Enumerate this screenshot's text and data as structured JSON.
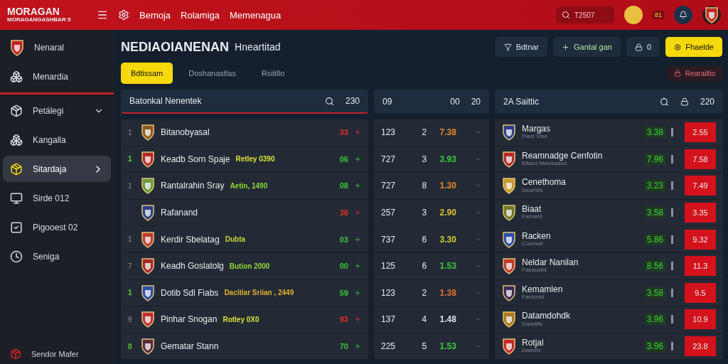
{
  "top_bar": {
    "brand": "MORAGAN",
    "brand_sub": "MORAGANGASHBAR 5",
    "nav": [
      "Bemoja",
      "Rolamiga",
      "Memenagua"
    ],
    "search": {
      "placeholder": "T2507"
    },
    "badge": "81"
  },
  "sidebar": {
    "items": [
      {
        "label": "Nenaral",
        "selected": false,
        "submenu": false
      },
      {
        "label": "Menardia",
        "selected": false,
        "submenu": false
      },
      {
        "label": "Petálegi",
        "selected": false,
        "submenu": true,
        "expanded": true
      },
      {
        "label": "Kangalla",
        "selected": false,
        "submenu": false
      },
      {
        "label": "Sitardaja",
        "selected": true,
        "submenu": true,
        "expanded": false
      },
      {
        "label": "Sirde 012",
        "selected": false,
        "submenu": false
      },
      {
        "label": "Pigooest 02",
        "selected": false,
        "submenu": false
      },
      {
        "label": "Seniga",
        "selected": false,
        "submenu": false
      }
    ],
    "footer": "Sendor Mafer"
  },
  "header": {
    "title": "NEDIAOIANENAN",
    "subtitle": "Hneartitad",
    "actions": [
      {
        "kind": "outline",
        "label": "Bdtnar"
      },
      {
        "kind": "green",
        "label": "Gantal gan"
      },
      {
        "kind": "icon",
        "label": "0"
      },
      {
        "kind": "primary",
        "label": "Fhaelde"
      }
    ]
  },
  "filters": [
    {
      "label": "Bdtissam",
      "selected": true
    },
    {
      "label": "Doshanastlas",
      "selected": false
    },
    {
      "label": "Rsitillo",
      "selected": false
    }
  ],
  "alert": "Rearailtio",
  "left_table": {
    "title": "Batonkal Nenentek",
    "count": "230",
    "rows": [
      {
        "rank": "1",
        "live": false,
        "name": "Bitanobyasal",
        "score": "33",
        "up": false,
        "color": "#8a5a1c"
      },
      {
        "rank": "1",
        "live": true,
        "name": "Keadb Sorn Spaje",
        "tag": {
          "text": "Retley 0390",
          "color": "#d8e03a"
        },
        "score": "06",
        "up": true,
        "color": "#b52a2a"
      },
      {
        "rank": "1",
        "live": false,
        "name": "Rantalrahin Sray",
        "tag": {
          "text": "Aetin, 1490",
          "color": "#8ed83a"
        },
        "score": "08",
        "up": true,
        "color": "#6a9a3a"
      },
      {
        "name": "Rafanand",
        "score": "38",
        "up": false,
        "color": "#2a3f8a"
      },
      {
        "rank": "1",
        "live": false,
        "name": "Kerdir Sbelatag",
        "tag": {
          "text": "Dubta",
          "color": "#c8d33a"
        },
        "score": "03",
        "up": true,
        "color": "#c0392b"
      },
      {
        "rank": "7",
        "live": false,
        "name": "Keadh Goslatolg",
        "tag": {
          "text": "Bution 2000",
          "color": "#8ed83a"
        },
        "score": "00",
        "up": true,
        "color": "#a82828"
      },
      {
        "rank": "1",
        "live": true,
        "name": "Dotib Sdl Fiabs",
        "tag": {
          "text": "Dacitiar Sriian , 2449",
          "color": "#e0b030"
        },
        "score": "59",
        "up": true,
        "color": "#2a4fa8"
      },
      {
        "rank": "9",
        "live": false,
        "name": "Pinhar Snogan",
        "tag": {
          "text": "Rotley 0X0",
          "color": "#d8e03a"
        },
        "score": "93",
        "up": false,
        "color": "#c03030"
      },
      {
        "rank": "0",
        "live": true,
        "name": "Gematar Stann",
        "score": "70",
        "up": true,
        "color": "#5a2a3a"
      }
    ]
  },
  "mid_table": {
    "columns": [
      "09",
      "00",
      "20"
    ],
    "rows": [
      {
        "a": "123",
        "b": "2",
        "odds": "7.38",
        "color": "#e08a2a"
      },
      {
        "a": "727",
        "b": "3",
        "odds": "3.93",
        "color": "#3ac83a"
      },
      {
        "a": "727",
        "b": "8",
        "odds": "1.30",
        "color": "#e08a2a"
      },
      {
        "a": "257",
        "b": "3",
        "odds": "2.90",
        "color": "#e0c030"
      },
      {
        "a": "737",
        "b": "6",
        "odds": "3.30",
        "color": "#c8d030"
      },
      {
        "a": "125",
        "b": "6",
        "odds": "1.53",
        "color": "#3ac83a"
      },
      {
        "a": "123",
        "b": "2",
        "odds": "1.38",
        "color": "#e07030"
      },
      {
        "a": "137",
        "b": "4",
        "odds": "1.48",
        "color": "#e0e0e0"
      },
      {
        "a": "225",
        "b": "5",
        "odds": "1.53",
        "color": "#3ac83a"
      }
    ]
  },
  "right_table": {
    "title": "2A Saittic",
    "count": "220",
    "rows": [
      {
        "name": "Margas",
        "sub": "Fiaot Visa",
        "odds": "3.38",
        "price": "2.55",
        "color": "#2a3f8a"
      },
      {
        "name": "Reamnadge Cenfotin",
        "sub": "Eitasd Mauisaasd",
        "odds": "7.96",
        "price": "7.58",
        "color": "#b52a2a"
      },
      {
        "name": "Cenethoma",
        "sub": "Dearhits",
        "odds": "3.23",
        "price": "7.49",
        "color": "#c89a2a"
      },
      {
        "name": "Biaat",
        "sub": "Farnield",
        "odds": "3.58",
        "price": "3.35",
        "color": "#6a7a2a"
      },
      {
        "name": "Racken",
        "sub": "Coomati",
        "odds": "5.86",
        "price": "9.32",
        "color": "#2a4fa8"
      },
      {
        "name": "Neldar Nanilan",
        "sub": "Fasasatid",
        "odds": "8.56",
        "price": "11.3",
        "color": "#c03a2a"
      },
      {
        "name": "Kemamlen",
        "sub": "Fardonid",
        "odds": "3.58",
        "price": "9.5",
        "color": "#3a2a5a"
      },
      {
        "name": "Datamdohdk",
        "sub": "Daastits",
        "odds": "3.96",
        "price": "10.9",
        "color": "#b0781c"
      },
      {
        "name": "Rotjal",
        "sub": "Daavits",
        "odds": "3.96",
        "price": "23.8",
        "color": "#c02a2a"
      }
    ]
  }
}
